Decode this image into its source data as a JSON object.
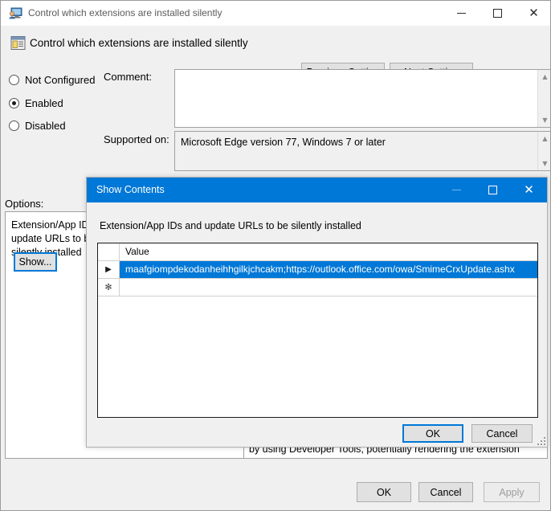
{
  "window": {
    "title": "Control which extensions are installed silently",
    "icon": "policy-setting-monitor-icon",
    "controls": {
      "minimize": "─",
      "maximize": "□",
      "close": "✕"
    }
  },
  "header": {
    "setting_title": "Control which extensions are installed silently",
    "icon": "group-policy-setting-icon",
    "previous_setting": "Previous Setting",
    "next_setting": "Next Setting"
  },
  "state": {
    "options": [
      {
        "label": "Not Configured",
        "checked": false
      },
      {
        "label": "Enabled",
        "checked": true
      },
      {
        "label": "Disabled",
        "checked": false
      }
    ]
  },
  "comment": {
    "label": "Comment:",
    "value": ""
  },
  "supported": {
    "label": "Supported on:",
    "value": "Microsoft Edge version 77, Windows 7 or later"
  },
  "options_section": {
    "label": "Options:",
    "policy_label": "Extension/App IDs and update URLs to be silently installed",
    "show_button": "Show..."
  },
  "help": {
    "text": "Note that users can modify the source code of any Extension by using Developer Tools, potentially rendering the extension",
    "scroll_glyph": "⌄"
  },
  "footer": {
    "ok": "OK",
    "cancel": "Cancel",
    "apply": "Apply",
    "apply_disabled": true
  },
  "dialog": {
    "title": "Show Contents",
    "description": "Extension/App IDs and update URLs to be silently installed",
    "controls": {
      "minimize": "─",
      "maximize": "□",
      "close": "✕"
    },
    "grid": {
      "columns": [
        "",
        "Value"
      ],
      "rows": [
        {
          "marker": "▶",
          "value": "maafgiompdekodanheihhgilkjchcakm;https://outlook.office.com/owa/SmimeCrxUpdate.ashx",
          "selected": true
        },
        {
          "marker": "✻",
          "value": "",
          "selected": false
        }
      ]
    },
    "ok": "OK",
    "cancel": "Cancel"
  },
  "colors": {
    "accent": "#0078d7",
    "window_bg": "#f0f0f0",
    "selection": "#0078d7",
    "title_text": "#5a5a5a"
  }
}
